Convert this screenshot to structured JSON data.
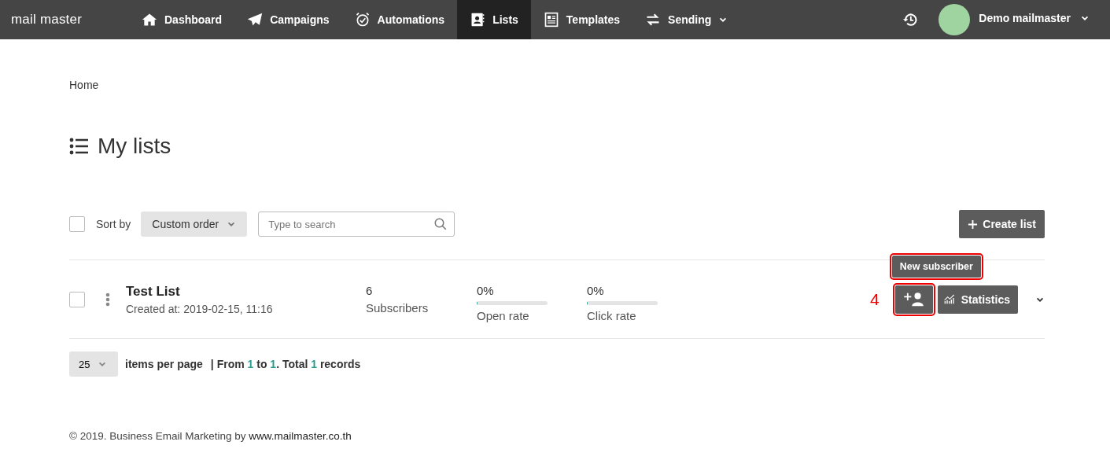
{
  "brand": "mail master",
  "nav": [
    {
      "label": "Dashboard",
      "kind": "home",
      "selected": false,
      "dropdown": false
    },
    {
      "label": "Campaigns",
      "kind": "plane",
      "selected": false,
      "dropdown": false
    },
    {
      "label": "Automations",
      "kind": "clock",
      "selected": false,
      "dropdown": false
    },
    {
      "label": "Lists",
      "kind": "book",
      "selected": true,
      "dropdown": false
    },
    {
      "label": "Templates",
      "kind": "paper",
      "selected": false,
      "dropdown": false
    },
    {
      "label": "Sending",
      "kind": "swap",
      "selected": false,
      "dropdown": true
    }
  ],
  "user": {
    "name": "Demo mailmaster"
  },
  "breadcrumb": [
    "Home"
  ],
  "page_title": "My lists",
  "toolbar": {
    "select_all_checked": false,
    "sort_label": "Sort by",
    "sort_value": "Custom order",
    "search_placeholder": "Type to search",
    "create_button": "Create list"
  },
  "lists": [
    {
      "name": "Test List",
      "created": "Created at: 2019-02-15, 11:16",
      "checked": false,
      "subscribers": "6",
      "subscribers_label": "Subscribers",
      "open": {
        "value": "0%",
        "level": 0,
        "label": "Open rate"
      },
      "click": {
        "value": "0%",
        "level": 0,
        "label": "Click rate"
      },
      "statistics_button": "Statistics"
    }
  ],
  "tooltip": {
    "text": "New subscriber",
    "highlighted": true
  },
  "callout": {
    "number": "4",
    "highlighted": true
  },
  "pagination": {
    "per_page": "25",
    "per_page_label": "items per page",
    "summary": [
      {
        "text": "| From ",
        "kind": "plain"
      },
      {
        "text": "1",
        "kind": "number"
      },
      {
        "text": " to ",
        "kind": "plain"
      },
      {
        "text": "1",
        "kind": "number"
      },
      {
        "text": ". Total ",
        "kind": "plain"
      },
      {
        "text": "1",
        "kind": "number"
      },
      {
        "text": " records",
        "kind": "plain"
      }
    ]
  },
  "footer": {
    "text": "© 2019. Business Email Marketing by",
    "link": "www.mailmaster.co.th"
  }
}
